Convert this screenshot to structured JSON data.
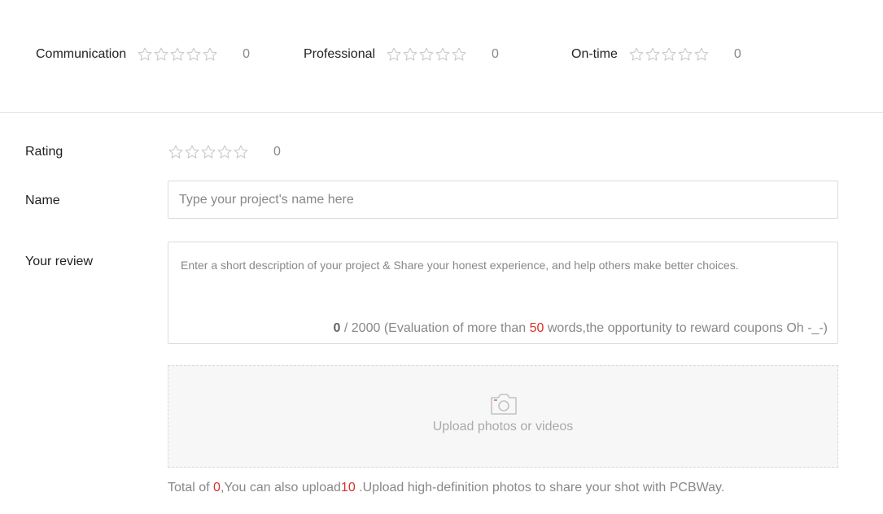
{
  "star_icon": "star-outline-icon",
  "star_count": 5,
  "categories": [
    {
      "label": "Communication",
      "score": "0"
    },
    {
      "label": "Professional",
      "score": "0"
    },
    {
      "label": "On-time",
      "score": "0"
    }
  ],
  "rating": {
    "label": "Rating",
    "score": "0"
  },
  "name": {
    "label": "Name",
    "placeholder": "Type your project's name here",
    "value": ""
  },
  "review": {
    "label": "Your review",
    "placeholder": "Enter a short description of your project & Share your honest experience, and help others make better choices.",
    "count": "0",
    "max_text": " / 2000 (Evaluation of more than ",
    "min_words": "50",
    "suffix": " words,the opportunity to reward coupons Oh -_-)"
  },
  "upload": {
    "label": "Upload photos or videos",
    "icon": "camera-icon",
    "note_prefix": "Total of ",
    "total": "0",
    "note_mid": ",You can also upload",
    "remaining": "10",
    "note_suffix": " .Upload high-definition photos to share your shot with PCBWay."
  },
  "colors": {
    "accent_red": "#d9302a",
    "star_outline": "#c8c8c8"
  }
}
